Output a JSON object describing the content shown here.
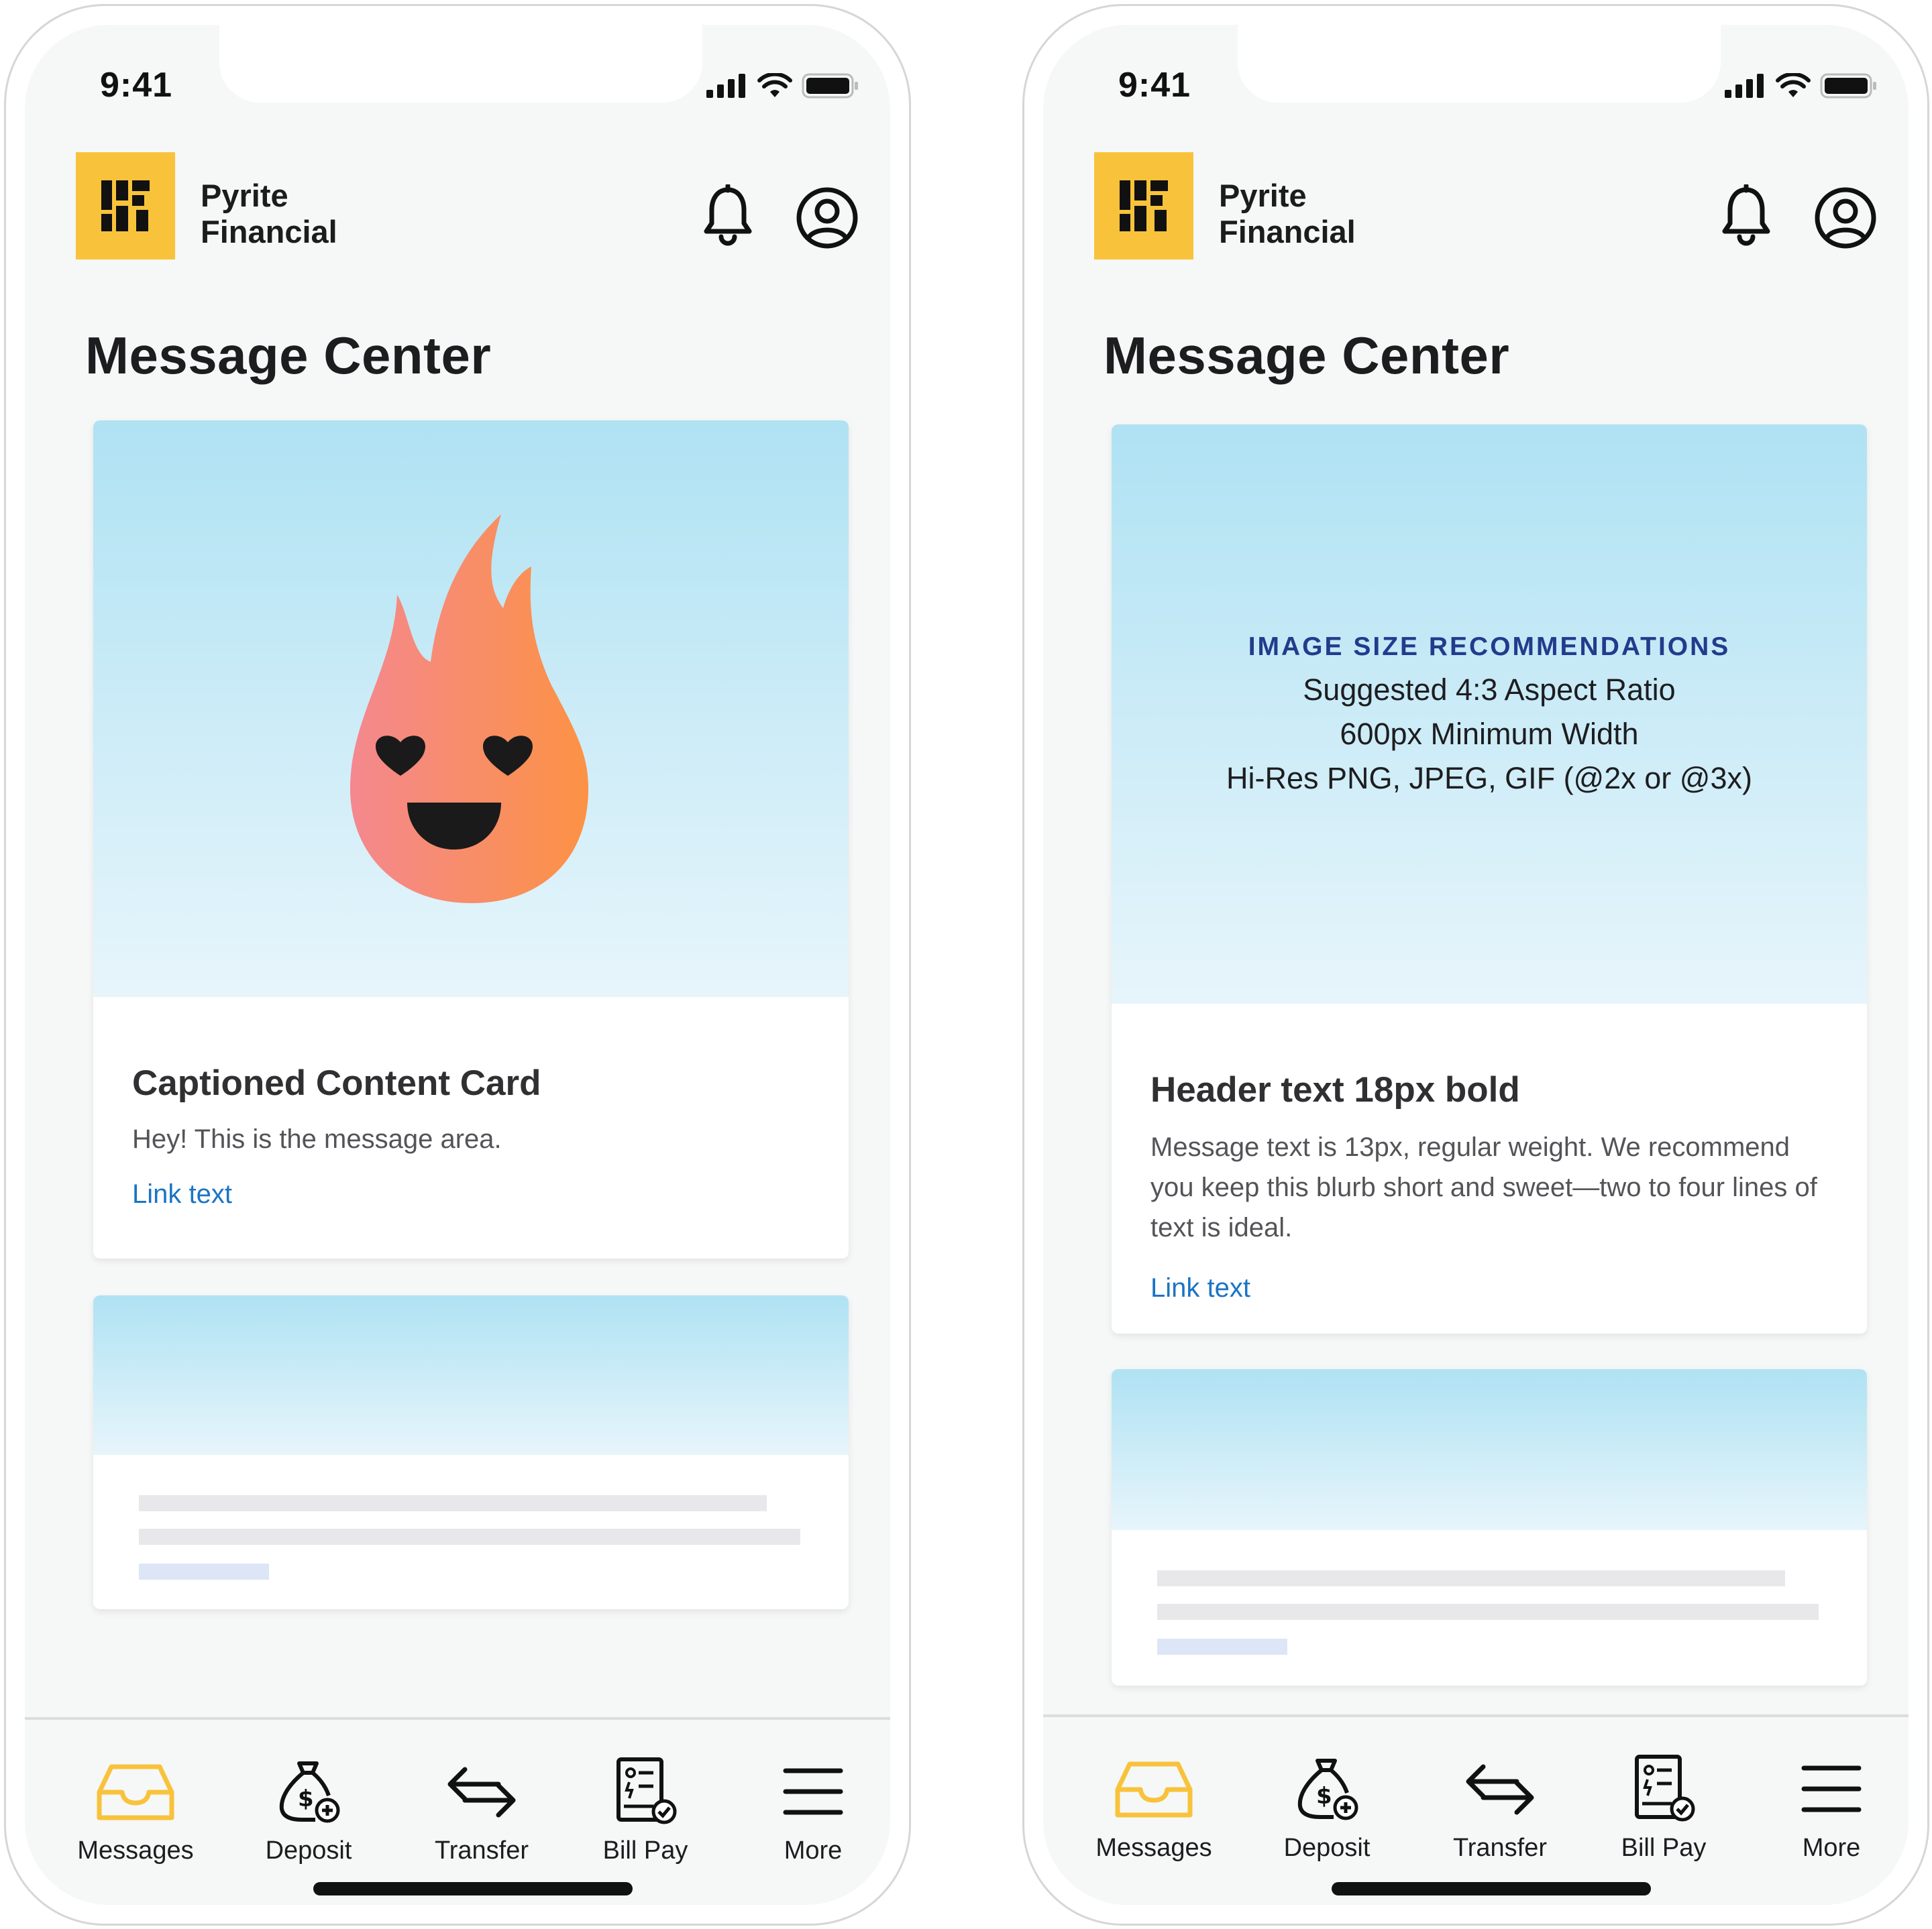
{
  "status": {
    "time": "9:41"
  },
  "brand": {
    "line1": "Pyrite",
    "line2": "Financial"
  },
  "page_title": "Message Center",
  "left_card": {
    "title": "Captioned Content Card",
    "message": "Hey! This is the message area.",
    "link": "Link text"
  },
  "right_card": {
    "image_heading": "IMAGE SIZE RECOMMENDATIONS",
    "image_lines": [
      "Suggested 4:3 Aspect Ratio",
      "600px Minimum Width",
      "Hi-Res PNG, JPEG, GIF (@2x or @3x)"
    ],
    "title": "Header text 18px bold",
    "message": "Message text is 13px, regular weight. We recommend you keep this blurb short and sweet—two to four lines of text is ideal.",
    "link": "Link text"
  },
  "tabs": [
    {
      "label": "Messages",
      "icon": "inbox-icon",
      "active": true
    },
    {
      "label": "Deposit",
      "icon": "money-bag-icon",
      "active": false
    },
    {
      "label": "Transfer",
      "icon": "transfer-arrows-icon",
      "active": false
    },
    {
      "label": "Bill Pay",
      "icon": "bill-icon",
      "active": false
    },
    {
      "label": "More",
      "icon": "hamburger-menu-icon",
      "active": false
    }
  ],
  "colors": {
    "accent": "#f8c33b",
    "link": "#1b74c5",
    "image_bg_top": "#afe2f3",
    "flame_start": "#f4888f",
    "flame_end": "#fc9244"
  }
}
